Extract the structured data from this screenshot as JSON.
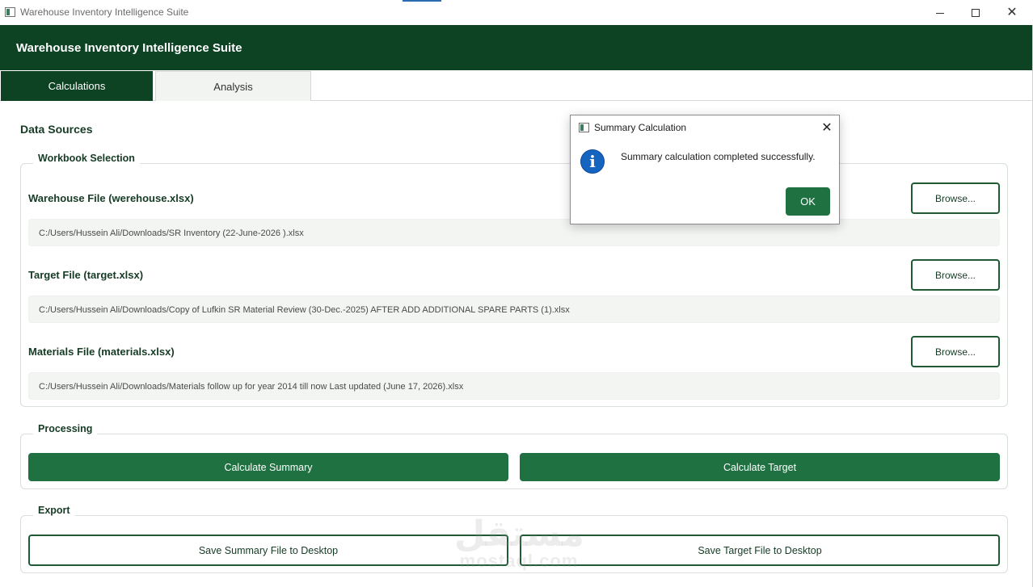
{
  "window": {
    "title": "Warehouse Inventory Intelligence Suite"
  },
  "header": {
    "title": "Warehouse Inventory Intelligence Suite"
  },
  "tabs": [
    {
      "label": "Calculations",
      "active": true
    },
    {
      "label": "Analysis",
      "active": false
    }
  ],
  "data_sources": {
    "heading": "Data Sources",
    "workbook_group": "Workbook Selection",
    "files": [
      {
        "label": "Warehouse File (werehouse.xlsx)",
        "path": "C:/Users/Hussein Ali/Downloads/SR Inventory (22-June-2026 ).xlsx",
        "browse_label": "Browse..."
      },
      {
        "label": "Target File (target.xlsx)",
        "path": "C:/Users/Hussein Ali/Downloads/Copy of Lufkin SR Material Review (30-Dec.-2025) AFTER ADD ADDITIONAL SPARE PARTS (1).xlsx",
        "browse_label": "Browse..."
      },
      {
        "label": "Materials File (materials.xlsx)",
        "path": "C:/Users/Hussein Ali/Downloads/Materials follow up for year 2014 till now Last updated (June 17, 2026).xlsx",
        "browse_label": "Browse..."
      }
    ]
  },
  "processing": {
    "group": "Processing",
    "calculate_summary": "Calculate Summary",
    "calculate_target": "Calculate Target"
  },
  "export": {
    "group": "Export",
    "save_summary": "Save Summary File to Desktop",
    "save_target": "Save Target File to Desktop"
  },
  "dialog": {
    "title": "Summary Calculation",
    "message": "Summary calculation completed successfully.",
    "ok_label": "OK",
    "icon": "info-icon"
  },
  "watermark": {
    "arabic": "مستقل",
    "latin": "mostaql.com"
  },
  "colors": {
    "header_bg": "#0d4223",
    "primary_button": "#1f7142",
    "outline_border": "#1f5a35",
    "info_icon": "#1565c0"
  }
}
